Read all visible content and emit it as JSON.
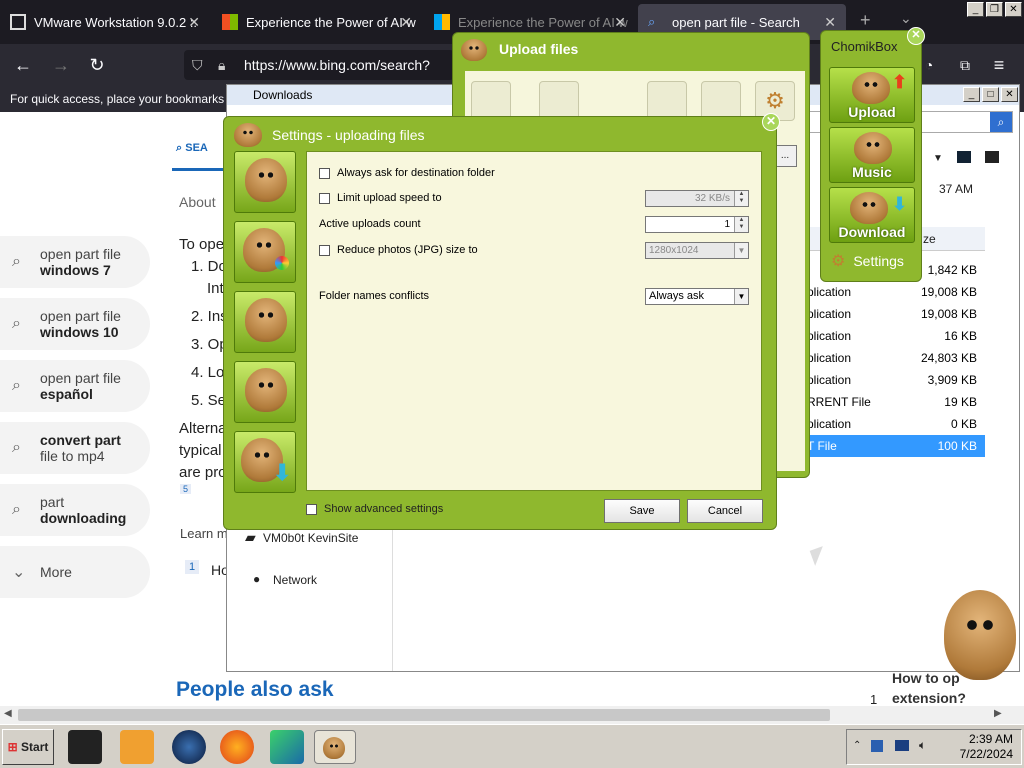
{
  "browser": {
    "tabs": [
      {
        "label": "VMware Workstation 9.0.2 ::"
      },
      {
        "label": "Experience the Power of AI w"
      },
      {
        "label": "Experience the Power of AI w"
      },
      {
        "label": "open part file - Search"
      }
    ],
    "url": "https://www.bing.com/search?form",
    "bookmarks_hint": "For quick access, place your bookmarks h"
  },
  "bing": {
    "search_tab": "SEA",
    "about_label": "About",
    "answer_intro": "To ope",
    "steps": [
      "1. Do",
      "Int",
      "2. Ins",
      "3. Op",
      "4. Lo",
      "5. Se"
    ],
    "alt_text": [
      "Alterna",
      "typical",
      "are pro"
    ],
    "cite": "5",
    "learn_more": "Learn m",
    "ref_num": "1",
    "ref_text": "Ho",
    "suggestions": [
      {
        "line1": "open part file",
        "line2": "windows 7"
      },
      {
        "line1": "open part file",
        "line2": "windows 10"
      },
      {
        "line1": "open part file",
        "line2": "español"
      },
      {
        "line1": "convert part",
        "line2": "file to mp4"
      },
      {
        "line1": "part",
        "line2": "downloading"
      }
    ],
    "more": "More",
    "people_also_ask": "People also ask",
    "related_num": "1",
    "related_q": [
      "How to op",
      "extension?"
    ]
  },
  "explorer": {
    "title": "Downloads",
    "time_col": "37 AM",
    "size_header": "ze",
    "nav": [
      "VM0b0t KevinSite",
      "Network"
    ],
    "rows": [
      {
        "type": "",
        "size": "1,842 KB"
      },
      {
        "type": "plication",
        "size": "19,008 KB"
      },
      {
        "type": "plication",
        "size": "19,008 KB"
      },
      {
        "type": "plication",
        "size": "16 KB"
      },
      {
        "type": "plication",
        "size": "24,803 KB"
      },
      {
        "type": "plication",
        "size": "3,909 KB"
      },
      {
        "type": "RRENT File",
        "size": "19 KB"
      },
      {
        "type": "plication",
        "size": "0 KB"
      },
      {
        "type": "T File",
        "size": "100 KB"
      }
    ]
  },
  "upload": {
    "title": "Upload files"
  },
  "chomikbox": {
    "title": "ChomikBox",
    "upload": "Upload",
    "music": "Music",
    "download": "Download",
    "settings": "Settings"
  },
  "settings": {
    "title": "Settings - uploading files",
    "always_ask": "Always ask for destination folder",
    "limit_speed": "Limit upload speed to",
    "speed_value": "32 KB/s",
    "active_uploads": "Active uploads count",
    "active_value": "1",
    "reduce_photos": "Reduce photos (JPG) size to",
    "photo_size": "1280x1024",
    "folder_conflicts": "Folder names conflicts",
    "conflict_value": "Always ask",
    "show_advanced": "Show advanced settings",
    "save": "Save",
    "cancel": "Cancel"
  },
  "taskbar": {
    "start": "Start",
    "time": "2:39 AM",
    "date": "7/22/2024"
  },
  "colors": {
    "chomik_green": "#8fb82e",
    "panel_bg": "#f8f7dd",
    "browser_dark": "#2b2a33",
    "selection": "#3399ff",
    "bing_heading": "#1a67b8"
  }
}
